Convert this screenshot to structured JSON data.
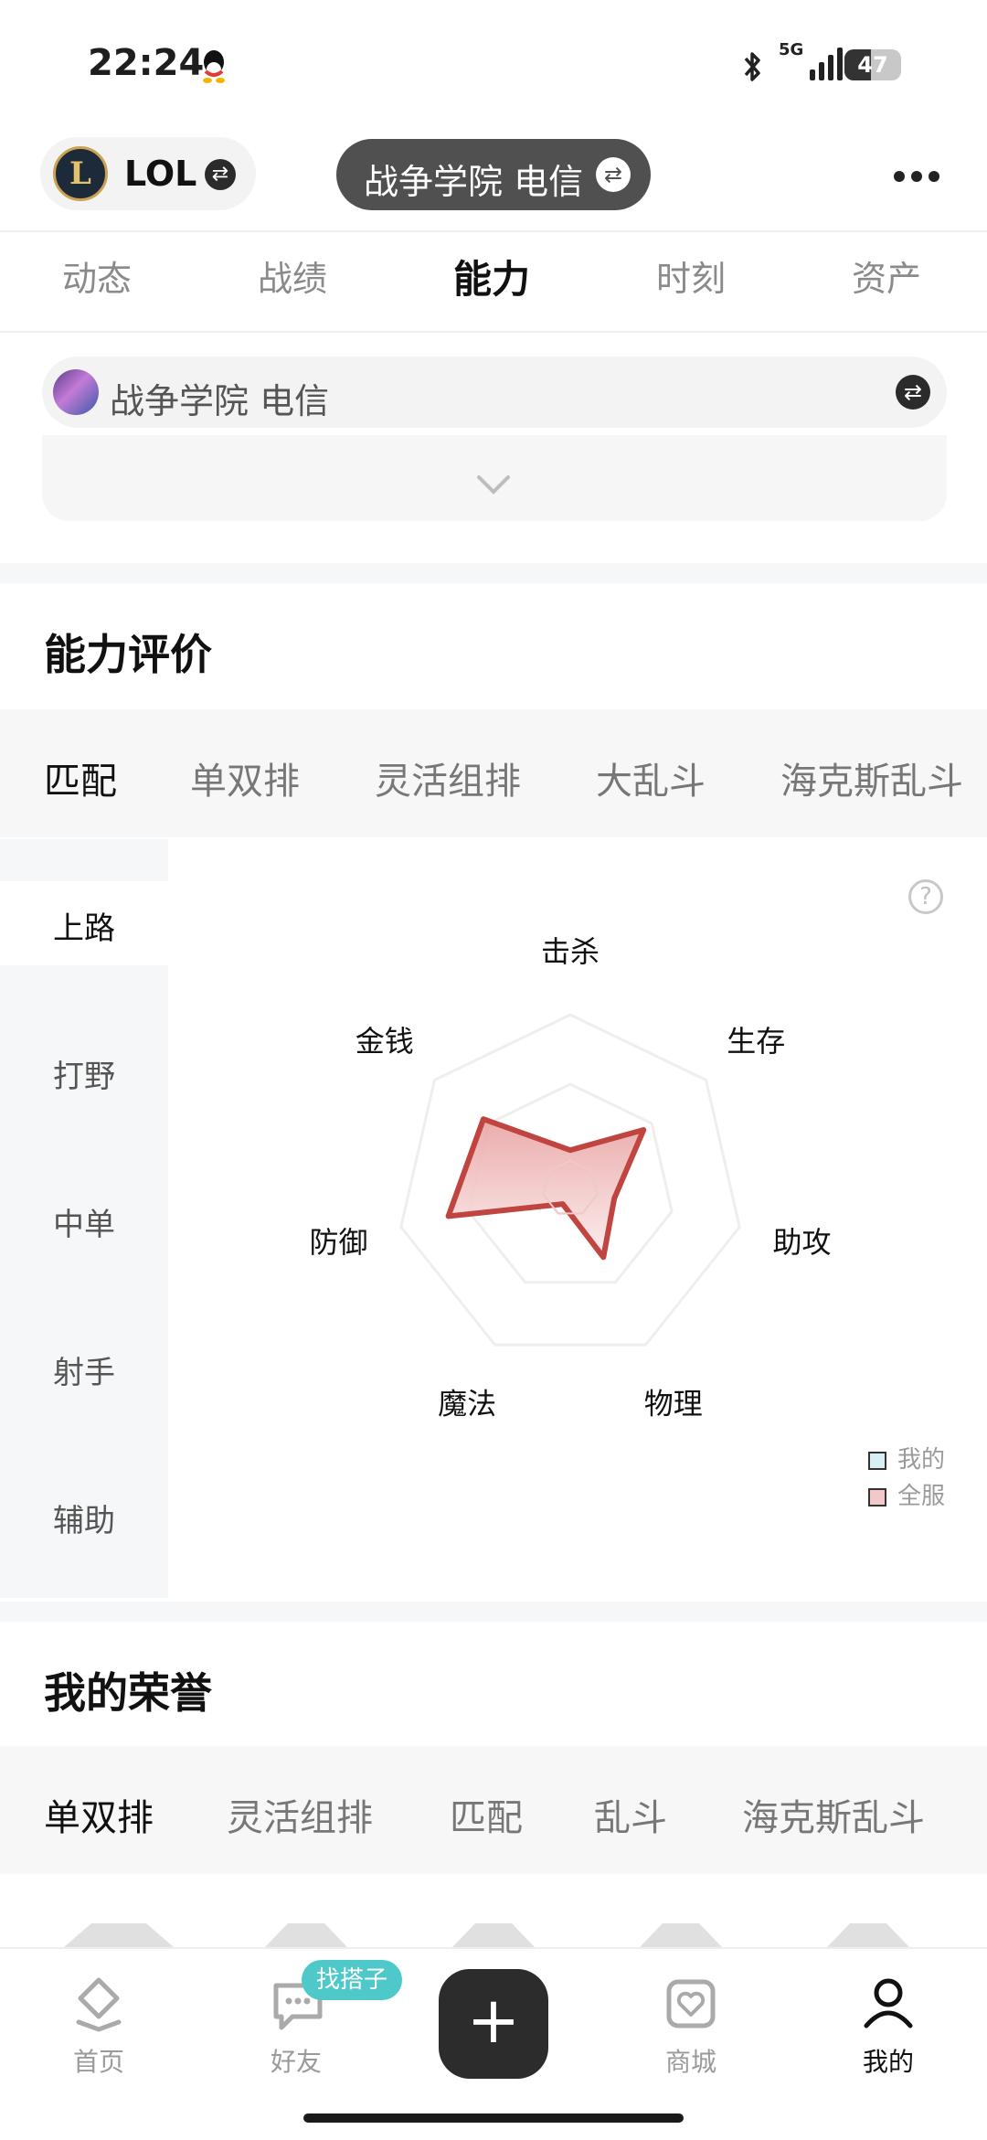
{
  "status_bar": {
    "time": "22:24",
    "network": "5G",
    "battery": "47",
    "battery_level": 0.47
  },
  "header": {
    "game": "LOL",
    "server": "战争学院 电信"
  },
  "main_tabs": [
    {
      "label": "动态"
    },
    {
      "label": "战绩"
    },
    {
      "label": "能力"
    },
    {
      "label": "时刻"
    },
    {
      "label": "资产"
    }
  ],
  "account": {
    "name": "战争学院 电信"
  },
  "ability": {
    "title": "能力评价",
    "modes": [
      "匹配",
      "单双排",
      "灵活组排",
      "大乱斗",
      "海克斯乱斗"
    ],
    "roles": [
      "上路",
      "打野",
      "中单",
      "射手",
      "辅助"
    ],
    "help": "?",
    "legend": [
      {
        "label": "我的",
        "color": "#d9eef7"
      },
      {
        "label": "全服",
        "color": "#f2c8c8"
      }
    ]
  },
  "chart_data": {
    "type": "radar",
    "axes": [
      "击杀",
      "生存",
      "助攻",
      "物理",
      "魔法",
      "防御",
      "金钱"
    ],
    "range": [
      0,
      100
    ],
    "series": [
      {
        "name": "全服",
        "values": [
          22,
          54,
          26,
          44,
          10,
          72,
          64
        ],
        "color": "#c0443f"
      },
      {
        "name": "我的",
        "values": [
          16,
          16,
          16,
          16,
          16,
          16,
          16
        ],
        "color": "#d9eef7"
      }
    ]
  },
  "honor": {
    "title": "我的荣誉",
    "modes": [
      "单双排",
      "灵活组排",
      "匹配",
      "乱斗",
      "海克斯乱斗"
    ]
  },
  "bottom_nav": {
    "items": [
      {
        "label": "首页"
      },
      {
        "label": "好友"
      },
      {
        "label": "商城"
      },
      {
        "label": "我的"
      }
    ],
    "badge": "找搭子",
    "plus": "+"
  }
}
